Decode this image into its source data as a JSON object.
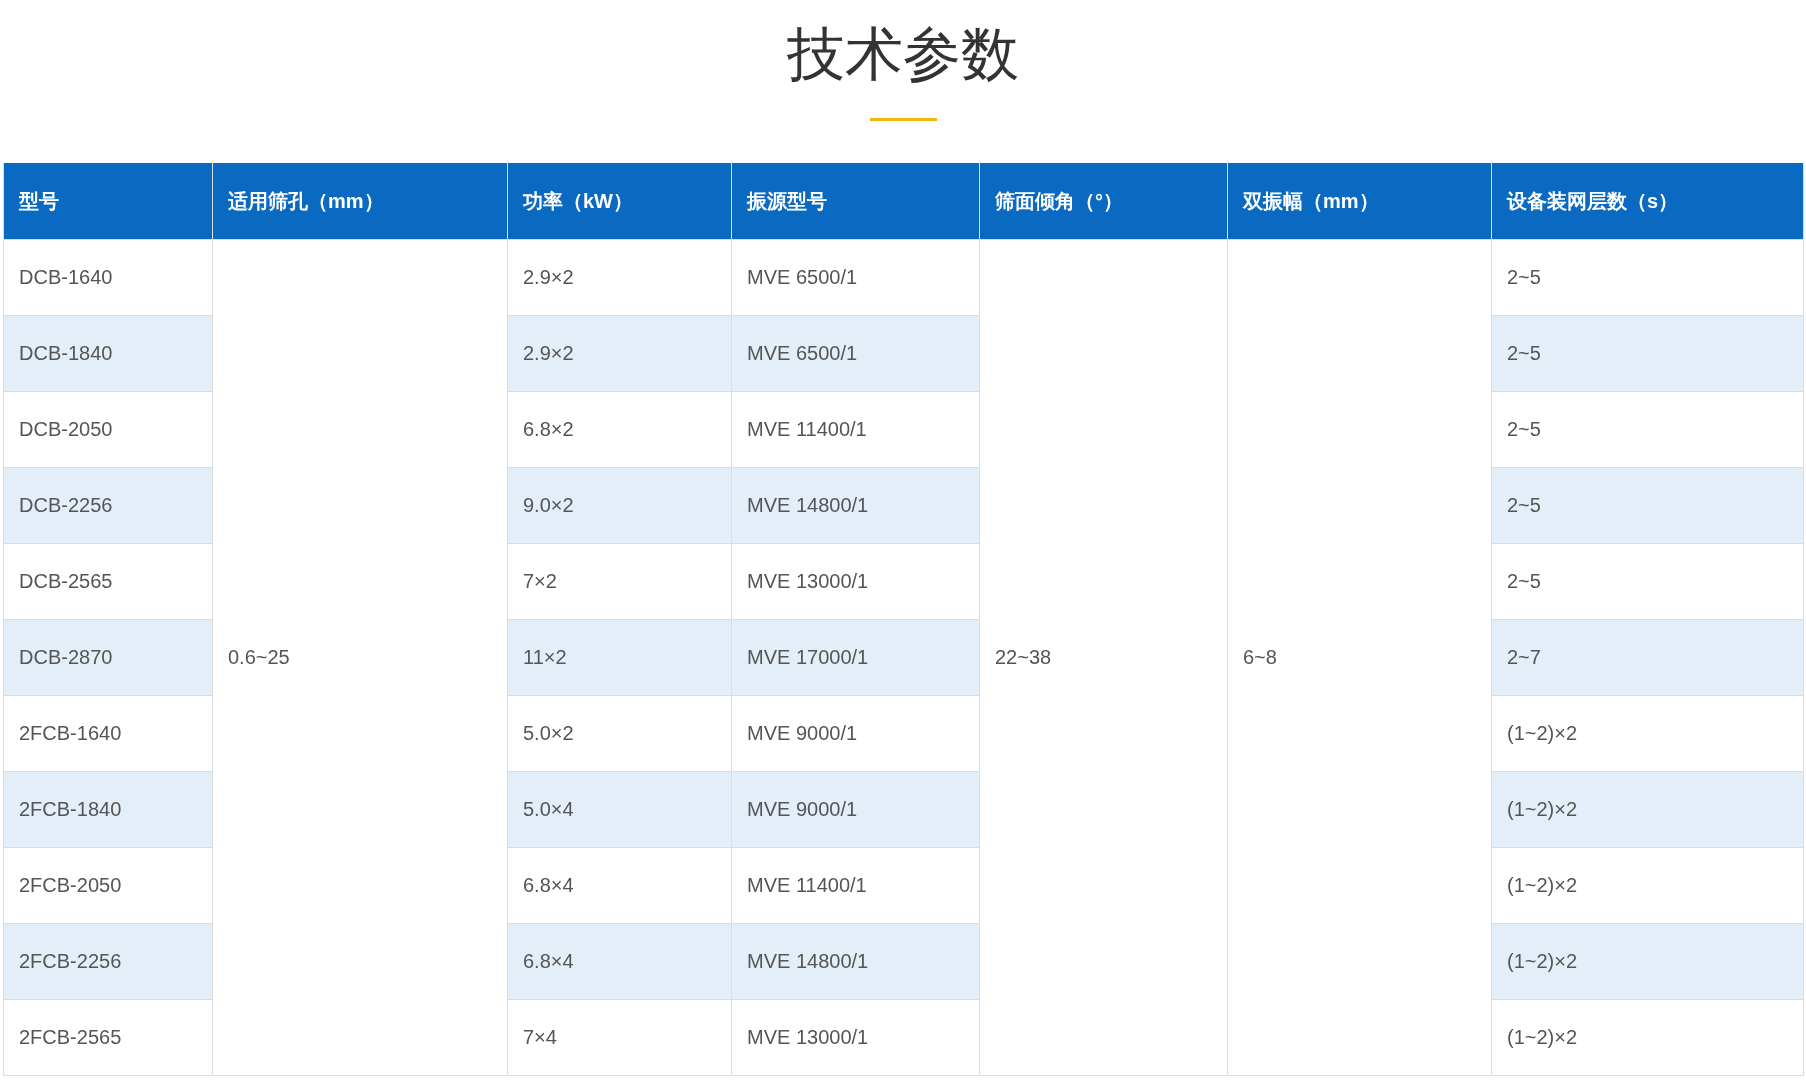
{
  "title": "技术参数",
  "table": {
    "columns": [
      "型号",
      "适用筛孔（mm）",
      "功率（kW）",
      "振源型号",
      "筛面倾角（°）",
      "双振幅（mm）",
      "设备装网层数（s）"
    ],
    "merged": {
      "aperture": "0.6~25",
      "angle": "22~38",
      "amplitude": "6~8"
    },
    "rows": [
      {
        "model": "DCB-1640",
        "power": "2.9×2",
        "vibrator": "MVE 6500/1",
        "layers": "2~5"
      },
      {
        "model": "DCB-1840",
        "power": "2.9×2",
        "vibrator": "MVE 6500/1",
        "layers": "2~5"
      },
      {
        "model": "DCB-2050",
        "power": "6.8×2",
        "vibrator": "MVE 11400/1",
        "layers": "2~5"
      },
      {
        "model": "DCB-2256",
        "power": "9.0×2",
        "vibrator": "MVE 14800/1",
        "layers": "2~5"
      },
      {
        "model": "DCB-2565",
        "power": "7×2",
        "vibrator": "MVE 13000/1",
        "layers": "2~5"
      },
      {
        "model": "DCB-2870",
        "power": "11×2",
        "vibrator": "MVE 17000/1",
        "layers": "2~7"
      },
      {
        "model": "2FCB-1640",
        "power": "5.0×2",
        "vibrator": "MVE 9000/1",
        "layers": "(1~2)×2"
      },
      {
        "model": "2FCB-1840",
        "power": "5.0×4",
        "vibrator": "MVE 9000/1",
        "layers": "(1~2)×2"
      },
      {
        "model": "2FCB-2050",
        "power": "6.8×4",
        "vibrator": "MVE 11400/1",
        "layers": "(1~2)×2"
      },
      {
        "model": "2FCB-2256",
        "power": "6.8×4",
        "vibrator": "MVE 14800/1",
        "layers": "(1~2)×2"
      },
      {
        "model": "2FCB-2565",
        "power": "7×4",
        "vibrator": "MVE 13000/1",
        "layers": "(1~2)×2"
      }
    ]
  }
}
